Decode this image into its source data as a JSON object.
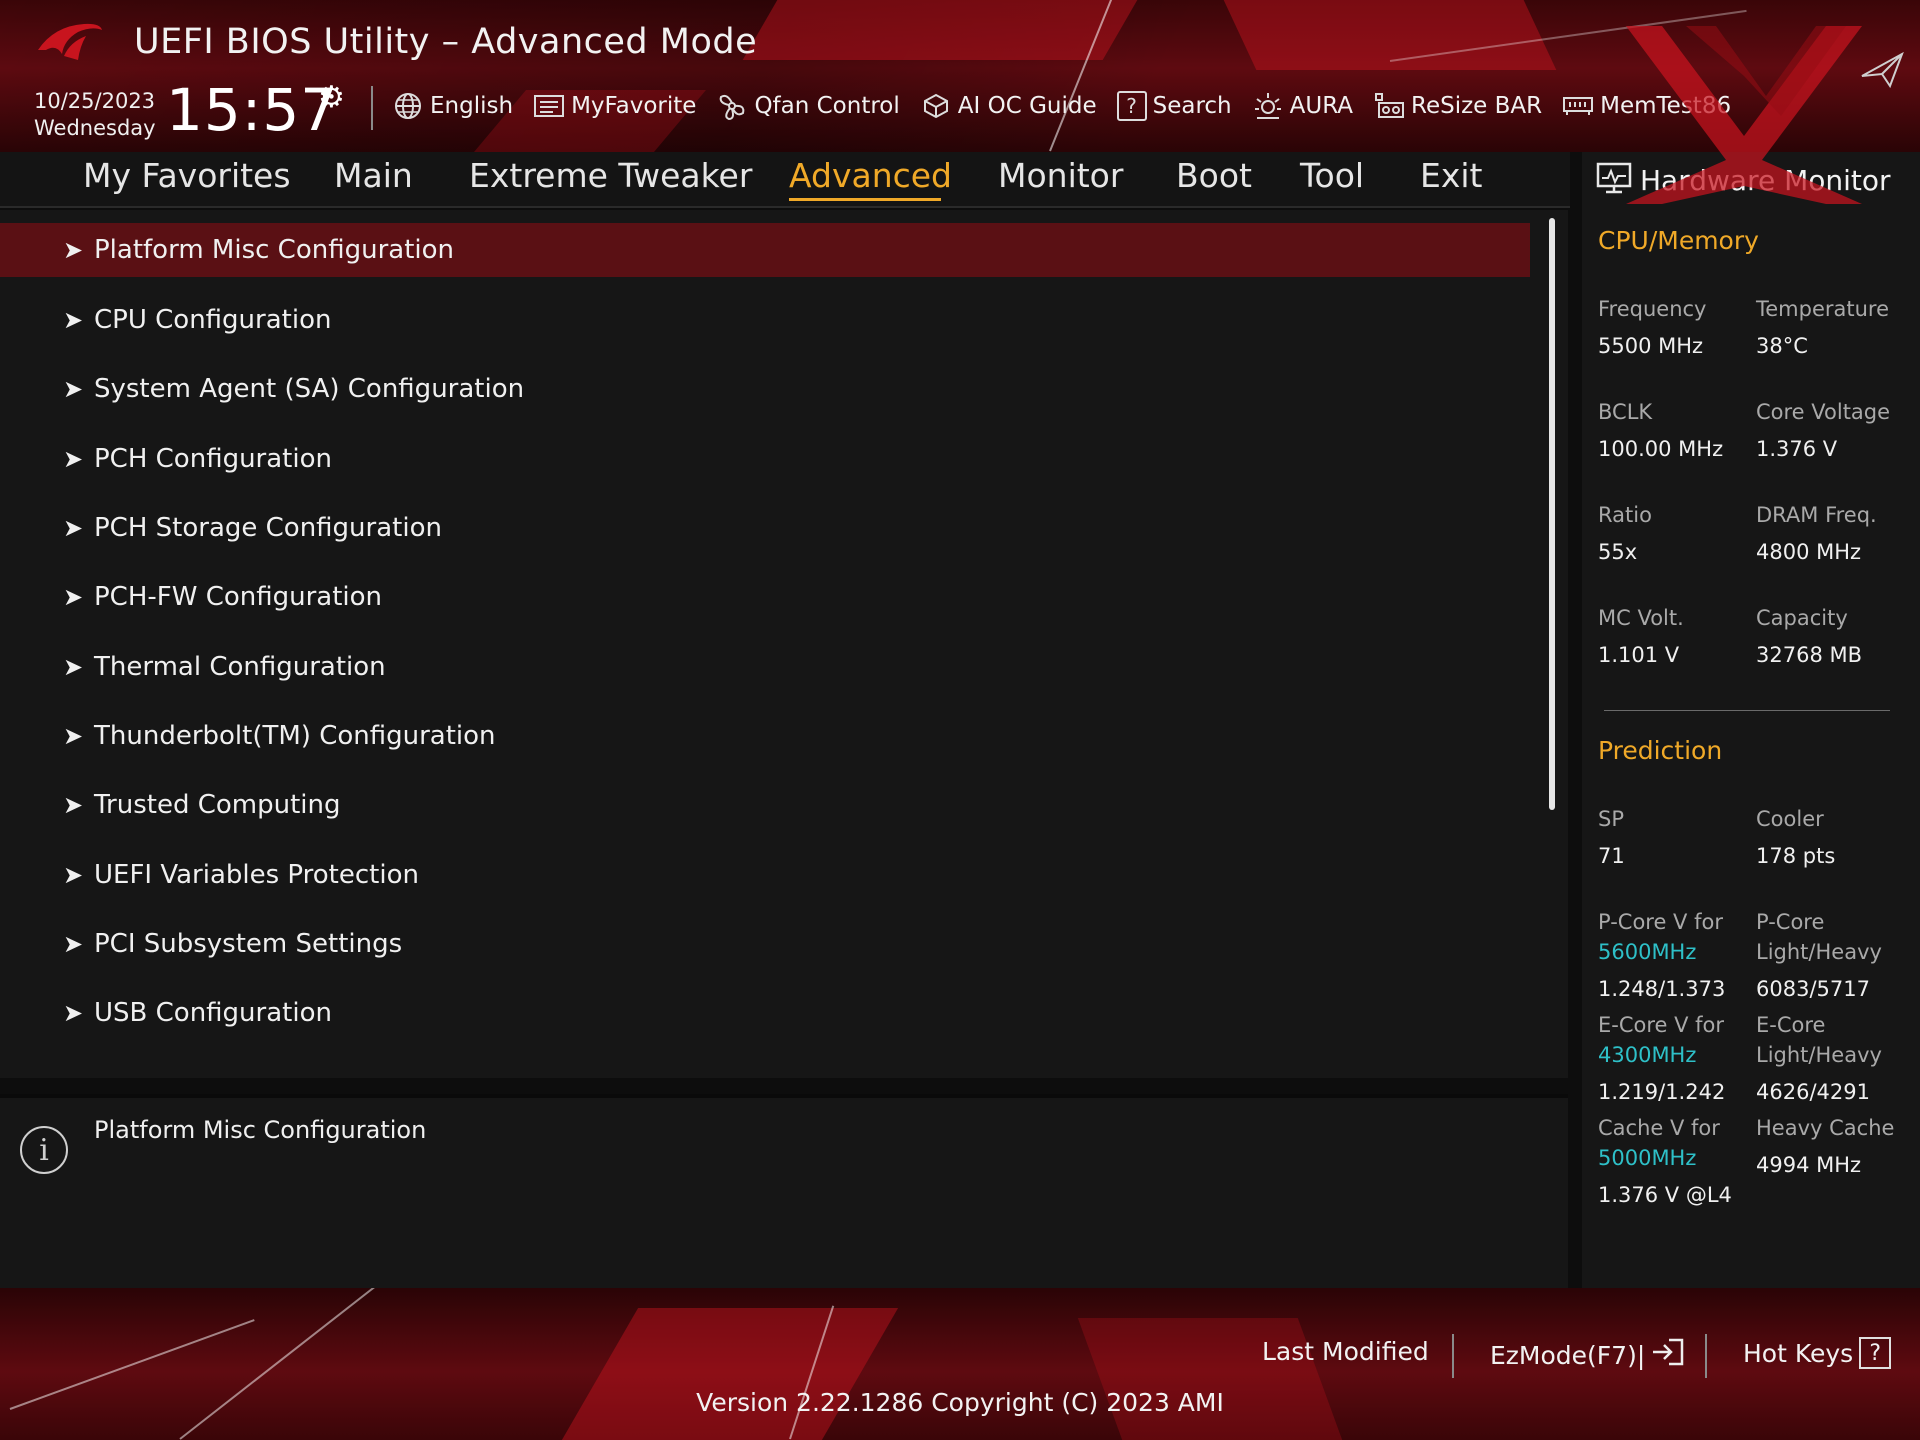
{
  "header": {
    "title": "UEFI BIOS Utility – Advanced Mode",
    "date": "10/25/2023",
    "day": "Wednesday",
    "time": "15:57",
    "toolbar": [
      {
        "label": "English",
        "icon": "globe-icon"
      },
      {
        "label": "MyFavorite",
        "icon": "favorite-icon"
      },
      {
        "label": "Qfan Control",
        "icon": "fan-icon"
      },
      {
        "label": "AI OC Guide",
        "icon": "ai-oc-guide-icon"
      },
      {
        "label": "Search",
        "icon": "search-icon"
      },
      {
        "label": "AURA",
        "icon": "aura-icon"
      },
      {
        "label": "ReSize BAR",
        "icon": "resize-bar-icon"
      },
      {
        "label": "MemTest86",
        "icon": "memtest-icon"
      }
    ]
  },
  "nav": {
    "tabs": [
      {
        "label": "My Favorites"
      },
      {
        "label": "Main"
      },
      {
        "label": "Extreme Tweaker"
      },
      {
        "label": "Advanced"
      },
      {
        "label": "Monitor"
      },
      {
        "label": "Boot"
      },
      {
        "label": "Tool"
      },
      {
        "label": "Exit"
      }
    ],
    "active": "Advanced"
  },
  "menu": {
    "items": [
      {
        "label": "Platform Misc Configuration"
      },
      {
        "label": "CPU Configuration"
      },
      {
        "label": "System Agent (SA) Configuration"
      },
      {
        "label": "PCH Configuration"
      },
      {
        "label": "PCH Storage Configuration"
      },
      {
        "label": "PCH-FW Configuration"
      },
      {
        "label": "Thermal Configuration"
      },
      {
        "label": "Thunderbolt(TM) Configuration"
      },
      {
        "label": "Trusted Computing"
      },
      {
        "label": "UEFI Variables Protection"
      },
      {
        "label": "PCI Subsystem Settings"
      },
      {
        "label": "USB Configuration"
      }
    ],
    "selected_index": 0
  },
  "help": {
    "text": "Platform Misc Configuration"
  },
  "hardware_monitor": {
    "title": "Hardware Monitor",
    "cpu_memory": {
      "heading": "CPU/Memory",
      "frequency_label": "Frequency",
      "frequency_value": "5500 MHz",
      "temperature_label": "Temperature",
      "temperature_value": "38°C",
      "bclk_label": "BCLK",
      "bclk_value": "100.00 MHz",
      "core_voltage_label": "Core Voltage",
      "core_voltage_value": "1.376 V",
      "ratio_label": "Ratio",
      "ratio_value": "55x",
      "dram_freq_label": "DRAM Freq.",
      "dram_freq_value": "4800 MHz",
      "mc_volt_label": "MC Volt.",
      "mc_volt_value": "1.101 V",
      "capacity_label": "Capacity",
      "capacity_value": "32768 MB"
    },
    "prediction": {
      "heading": "Prediction",
      "sp_label": "SP",
      "sp_value": "71",
      "cooler_label": "Cooler",
      "cooler_value": "178 pts",
      "pcore_v_label": "P-Core V for",
      "pcore_v_freq": "5600MHz",
      "pcore_v_value": "1.248/1.373",
      "pcore_lh_label_1": "P-Core",
      "pcore_lh_label_2": "Light/Heavy",
      "pcore_lh_value": "6083/5717",
      "ecore_v_label": "E-Core V for",
      "ecore_v_freq": "4300MHz",
      "ecore_v_value": "1.219/1.242",
      "ecore_lh_label_1": "E-Core",
      "ecore_lh_label_2": "Light/Heavy",
      "ecore_lh_value": "4626/4291",
      "cache_v_label": "Cache V for",
      "cache_v_freq": "5000MHz",
      "cache_v_value": "1.376 V @L4",
      "heavy_cache_label": "Heavy Cache",
      "heavy_cache_value": "4994 MHz"
    }
  },
  "footer": {
    "last_modified": "Last Modified",
    "ezmode": "EzMode(F7)|",
    "hot_keys": "Hot Keys",
    "version": "Version 2.22.1286 Copyright (C) 2023 AMI"
  },
  "colors": {
    "accent": "#f0a928",
    "selection": "#5a1014",
    "prediction_freq": "#2ec0c8",
    "brand_red": "#c8141e"
  }
}
